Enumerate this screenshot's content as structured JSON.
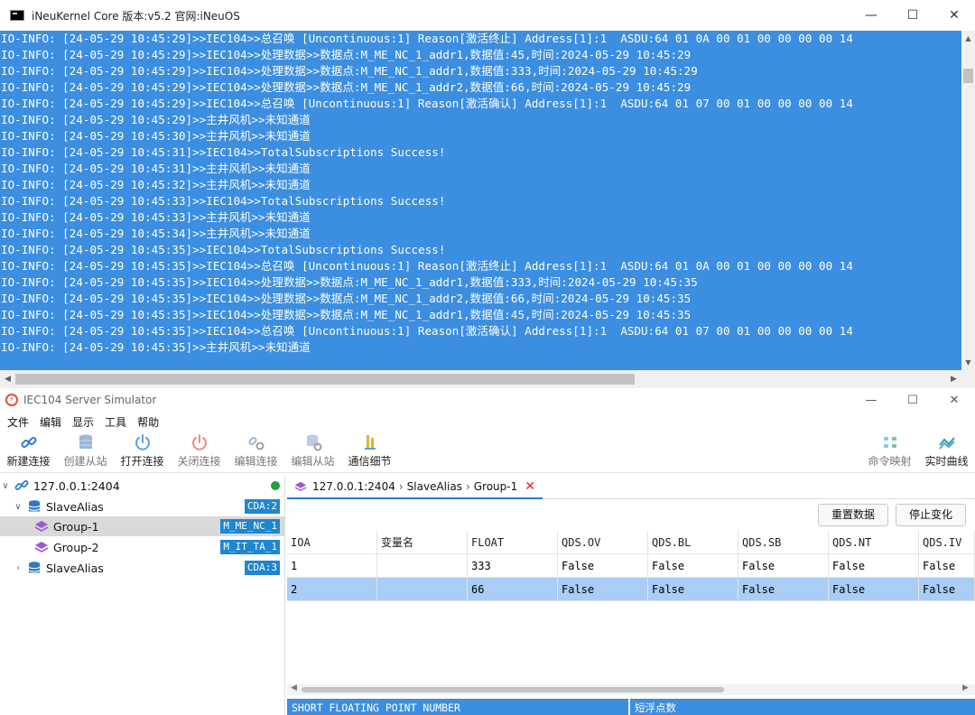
{
  "console": {
    "title": "iNeuKernel Core 版本:v5.2 官网:iNeuOS",
    "lines": [
      "IO-INFO: [24-05-29 10:45:29]>>IEC104>>总召唤 [Uncontinuous:1] Reason[激活终止] Address[1]:1  ASDU:64 01 0A 00 01 00 00 00 00 14",
      "IO-INFO: [24-05-29 10:45:29]>>IEC104>>处理数据>>数据点:M_ME_NC_1_addr1,数据值:45,时间:2024-05-29 10:45:29",
      "IO-INFO: [24-05-29 10:45:29]>>IEC104>>处理数据>>数据点:M_ME_NC_1_addr1,数据值:333,时间:2024-05-29 10:45:29",
      "IO-INFO: [24-05-29 10:45:29]>>IEC104>>处理数据>>数据点:M_ME_NC_1_addr2,数据值:66,时间:2024-05-29 10:45:29",
      "IO-INFO: [24-05-29 10:45:29]>>IEC104>>总召唤 [Uncontinuous:1] Reason[激活确认] Address[1]:1  ASDU:64 01 07 00 01 00 00 00 00 14",
      "IO-INFO: [24-05-29 10:45:29]>>主井风机>>未知通道",
      "IO-INFO: [24-05-29 10:45:30]>>主井风机>>未知通道",
      "IO-INFO: [24-05-29 10:45:31]>>IEC104>>TotalSubscriptions Success!",
      "IO-INFO: [24-05-29 10:45:31]>>主井风机>>未知通道",
      "IO-INFO: [24-05-29 10:45:32]>>主井风机>>未知通道",
      "IO-INFO: [24-05-29 10:45:33]>>IEC104>>TotalSubscriptions Success!",
      "IO-INFO: [24-05-29 10:45:33]>>主井风机>>未知通道",
      "IO-INFO: [24-05-29 10:45:34]>>主井风机>>未知通道",
      "IO-INFO: [24-05-29 10:45:35]>>IEC104>>TotalSubscriptions Success!",
      "IO-INFO: [24-05-29 10:45:35]>>IEC104>>总召唤 [Uncontinuous:1] Reason[激活终止] Address[1]:1  ASDU:64 01 0A 00 01 00 00 00 00 14",
      "IO-INFO: [24-05-29 10:45:35]>>IEC104>>处理数据>>数据点:M_ME_NC_1_addr1,数据值:333,时间:2024-05-29 10:45:35",
      "IO-INFO: [24-05-29 10:45:35]>>IEC104>>处理数据>>数据点:M_ME_NC_1_addr2,数据值:66,时间:2024-05-29 10:45:35",
      "IO-INFO: [24-05-29 10:45:35]>>IEC104>>处理数据>>数据点:M_ME_NC_1_addr1,数据值:45,时间:2024-05-29 10:45:35",
      "IO-INFO: [24-05-29 10:45:35]>>IEC104>>总召唤 [Uncontinuous:1] Reason[激活确认] Address[1]:1  ASDU:64 01 07 00 01 00 00 00 00 14",
      "IO-INFO: [24-05-29 10:45:35]>>主井风机>>未知通道"
    ]
  },
  "simulator": {
    "title": "IEC104 Server Simulator",
    "menu": [
      "文件",
      "编辑",
      "显示",
      "工具",
      "帮助"
    ],
    "toolbar": [
      {
        "label": "新建连接",
        "icon": "link-icon",
        "enabled": true
      },
      {
        "label": "创建从站",
        "icon": "database-icon",
        "enabled": false
      },
      {
        "label": "打开连接",
        "icon": "power-icon",
        "enabled": true
      },
      {
        "label": "关闭连接",
        "icon": "power-off-icon",
        "enabled": false
      },
      {
        "label": "编辑连接",
        "icon": "link-settings-icon",
        "enabled": false
      },
      {
        "label": "编辑从站",
        "icon": "database-settings-icon",
        "enabled": false
      },
      {
        "label": "通信细节",
        "icon": "bars-icon",
        "enabled": true
      }
    ],
    "toolbar_right": [
      {
        "label": "命令映射",
        "icon": "command-map-icon",
        "enabled": false
      },
      {
        "label": "实时曲线",
        "icon": "line-chart-icon",
        "enabled": true
      }
    ],
    "tree": {
      "connection": "127.0.0.1:2404",
      "slaves": [
        {
          "label": "SlaveAlias",
          "tag": "CDA:2",
          "expanded": true
        },
        {
          "label": "SlaveAlias",
          "tag": "CDA:3",
          "expanded": false
        }
      ],
      "groups": [
        {
          "label": "Group-1",
          "tag": "M_ME_NC_1"
        },
        {
          "label": "Group-2",
          "tag": "M_IT_TA_1"
        }
      ]
    },
    "tab": {
      "crumbs": [
        "127.0.0.1:2404",
        "SlaveAlias",
        "Group-1"
      ]
    },
    "buttons": {
      "reset": "重置数据",
      "stop": "停止变化"
    },
    "grid": {
      "columns": [
        "IOA",
        "变量名",
        "FLOAT",
        "QDS.OV",
        "QDS.BL",
        "QDS.SB",
        "QDS.NT",
        "QDS.IV"
      ],
      "rows": [
        [
          "1",
          "",
          "333",
          "False",
          "False",
          "False",
          "False",
          "False"
        ],
        [
          "2",
          "",
          "66",
          "False",
          "False",
          "False",
          "False",
          "False"
        ]
      ]
    },
    "footer": [
      "SHORT FLOATING POINT NUMBER",
      "短浮点数"
    ],
    "colors": {
      "console_bg": "#3c8ee0",
      "selection": "#a9cdf5",
      "tag": "#1f86d0",
      "status": "#22a23a"
    }
  }
}
